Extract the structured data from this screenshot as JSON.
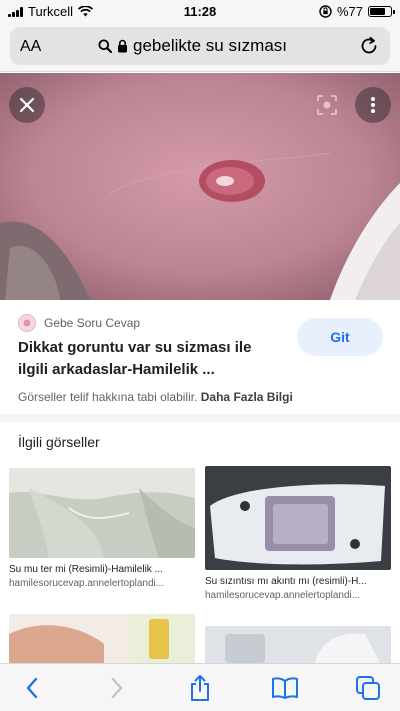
{
  "status_bar": {
    "carrier": "Turkcell",
    "time": "11:28",
    "battery_text": "%77",
    "battery_level": 0.77
  },
  "browser": {
    "text_size_label": "AA",
    "url_text": "gebelikte su sızması"
  },
  "result": {
    "source_name": "Gebe Soru Cevap",
    "title": "Dikkat goruntu var su sizması ile ilgili arkadaslar-Hamilelik ...",
    "visit_button": "Git",
    "copyright_notice": "Görseller telif hakkına tabi olabilir.",
    "learn_more": "Daha Fazla Bilgi"
  },
  "related": {
    "heading": "İlgili görseller",
    "items": [
      {
        "title": "Su mu ter mi (Resimli)-Hamilelik ...",
        "source": "hamilesorucevap.annelertoplandi..."
      },
      {
        "title": "Su sızıntısı mı akıntı mı (resimli)-H...",
        "source": "hamilesorucevap.annelertoplandi..."
      }
    ]
  },
  "colors": {
    "accent": "#1a73e8",
    "button_bg": "#e8f0fe"
  }
}
